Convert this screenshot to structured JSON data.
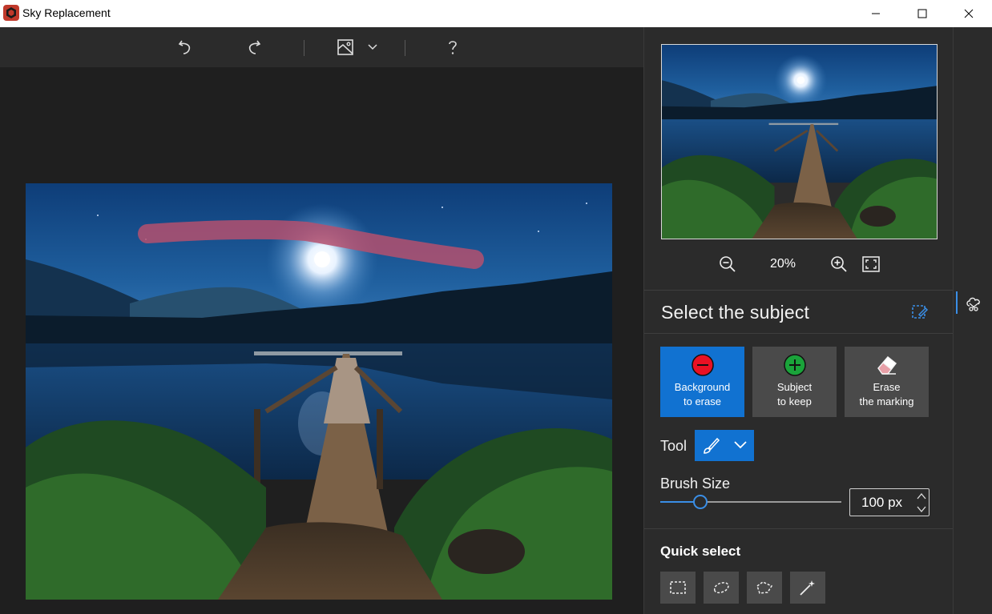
{
  "window": {
    "title": "Sky Replacement",
    "logo_color": "#c0392b"
  },
  "toolbar": {
    "icons": [
      "undo-icon",
      "redo-icon",
      "view-mode-icon",
      "chevron-down-icon",
      "help-icon"
    ]
  },
  "preview": {
    "zoom_value": "20%"
  },
  "panel": {
    "section_title": "Select the subject",
    "modes": [
      {
        "label_line1": "Background",
        "label_line2": "to erase",
        "icon": "minus-circle-icon",
        "icon_color": "#e81123",
        "active": true
      },
      {
        "label_line1": "Subject",
        "label_line2": "to keep",
        "icon": "plus-circle-icon",
        "icon_color": "#1aa33a",
        "active": false
      },
      {
        "label_line1": "Erase",
        "label_line2": "the marking",
        "icon": "eraser-icon",
        "icon_color": "#e8a0a8",
        "active": false
      }
    ],
    "tool_label": "Tool",
    "brush_size_label": "Brush Size",
    "brush_size_value": "100 px",
    "brush_size_fraction": 0.22,
    "quick_select_title": "Quick select",
    "quick_select_tools": [
      "rectangle-select-icon",
      "ellipse-lasso-icon",
      "polygon-lasso-icon",
      "magic-wand-icon"
    ]
  },
  "colors": {
    "accent": "#1172d1",
    "slider_accent": "#3a8ee6",
    "marking": "#b4506e"
  }
}
